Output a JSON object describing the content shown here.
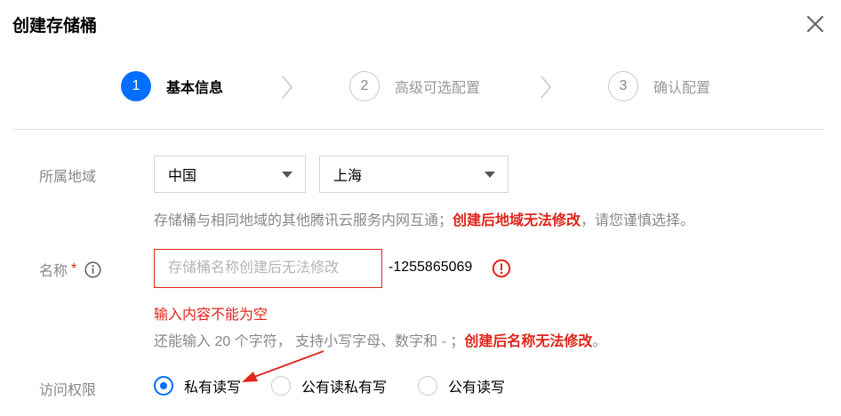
{
  "dialog": {
    "title": "创建存储桶"
  },
  "steps": [
    {
      "number": "1",
      "label": "基本信息"
    },
    {
      "number": "2",
      "label": "高级可选配置"
    },
    {
      "number": "3",
      "label": "确认配置"
    }
  ],
  "region": {
    "label": "所属地域",
    "country": "中国",
    "city": "上海",
    "hint": "存储桶与相同地域的其他腾讯云服务内网互通；",
    "hint_warn": "创建后地域无法修改",
    "hint_tail": "，请您谨慎选择。"
  },
  "name": {
    "label": "名称",
    "required_mark": "*",
    "placeholder": "存储桶名称创建后无法修改",
    "suffix": "-1255865069",
    "error": "输入内容不能为空",
    "hint": "还能输入 20 个字符， 支持小写字母、数字和 - ；",
    "hint_warn": "创建后名称无法修改",
    "hint_tail": "。"
  },
  "access": {
    "label": "访问权限",
    "options": [
      {
        "label": "私有读写",
        "checked": true
      },
      {
        "label": "公有读私有写",
        "checked": false
      },
      {
        "label": "公有读写",
        "checked": false
      }
    ]
  },
  "colors": {
    "primary": "#006eff",
    "error": "#e1251b",
    "annotation_arrow": "#e1251b"
  }
}
